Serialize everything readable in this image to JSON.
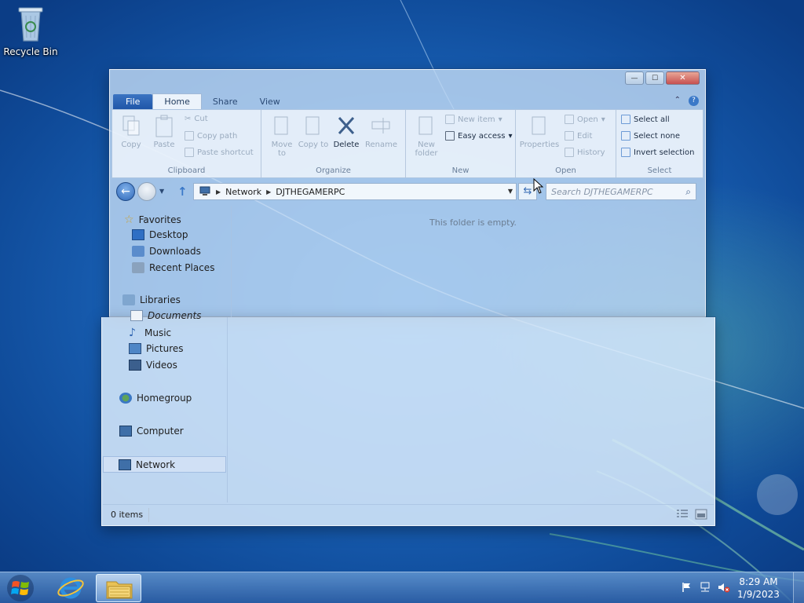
{
  "desktop": {
    "icons": [
      {
        "label": "Recycle Bin",
        "icon": "recycle-bin-icon"
      }
    ]
  },
  "window": {
    "caption_buttons": {
      "minimize": "—",
      "maximize": "☐",
      "close": "✕"
    },
    "tabs": [
      {
        "label": "File"
      },
      {
        "label": "Home"
      },
      {
        "label": "Share"
      },
      {
        "label": "View"
      }
    ],
    "ribbon": {
      "clipboard": {
        "label": "Clipboard",
        "copy": "Copy",
        "paste": "Paste",
        "cut": "Cut",
        "copy_path": "Copy path",
        "paste_shortcut": "Paste shortcut"
      },
      "organize": {
        "label": "Organize",
        "move_to": "Move to",
        "copy_to": "Copy to",
        "delete": "Delete",
        "rename": "Rename"
      },
      "new": {
        "label": "New",
        "new_folder": "New folder",
        "new_item": "New item",
        "easy_access": "Easy access"
      },
      "open": {
        "label": "Open",
        "properties": "Properties",
        "open": "Open",
        "edit": "Edit",
        "history": "History"
      },
      "select": {
        "label": "Select",
        "select_all": "Select all",
        "select_none": "Select none",
        "invert_selection": "Invert selection"
      }
    },
    "address": {
      "crumbs": [
        "Network",
        "DJTHEGAMERPC"
      ]
    },
    "search": {
      "placeholder": "Search DJTHEGAMERPC"
    },
    "nav": {
      "favorites": "Favorites",
      "desktop": "Desktop",
      "downloads": "Downloads",
      "recent_places": "Recent Places",
      "libraries": "Libraries",
      "documents": "Documents",
      "music": "Music",
      "pictures": "Pictures",
      "videos": "Videos",
      "homegroup": "Homegroup",
      "computer": "Computer",
      "network": "Network"
    },
    "content": {
      "empty_message": "This folder is empty."
    },
    "status": {
      "items": "0 items"
    }
  },
  "taskbar": {
    "clock_time": "8:29 AM",
    "clock_date": "1/9/2023"
  }
}
